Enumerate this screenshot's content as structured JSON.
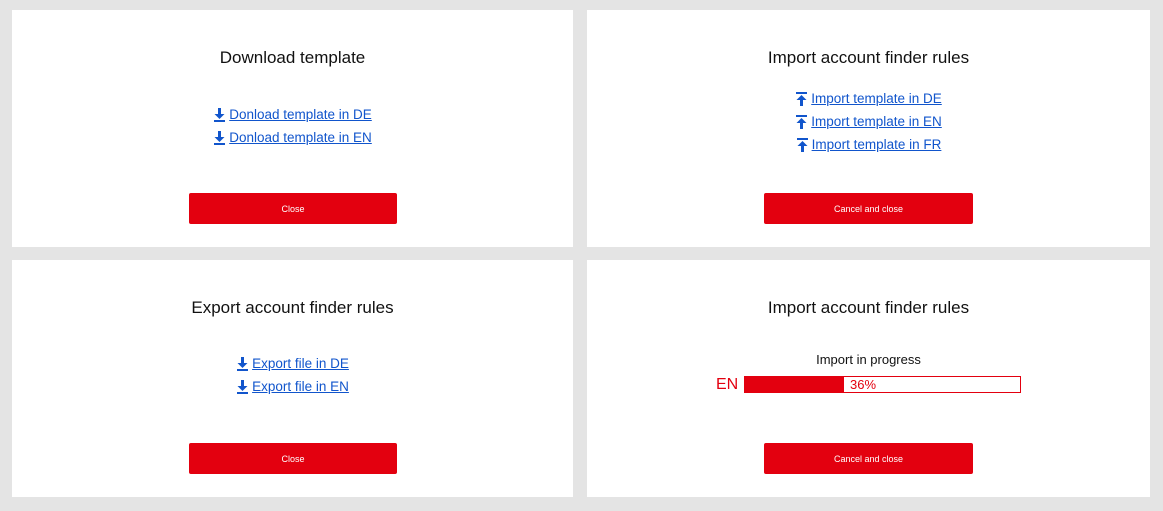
{
  "panels": {
    "download_template": {
      "title": "Download template",
      "links": [
        "Donload template in DE",
        "Donload template in EN"
      ],
      "button": "Close"
    },
    "import_rules": {
      "title": "Import account finder rules",
      "links": [
        "Import template in DE",
        "Import template in EN",
        "Import template in FR"
      ],
      "button": "Cancel and close"
    },
    "export_rules": {
      "title": "Export account finder rules",
      "links": [
        "Export file in DE",
        "Export file in EN"
      ],
      "button": "Close"
    },
    "import_progress": {
      "title": "Import account finder rules",
      "status": "Import in progress",
      "language": "EN",
      "progress_fraction": 0.36,
      "progress_text": "36%",
      "button": "Cancel and close"
    }
  },
  "colors": {
    "accent": "#e3000f",
    "link": "#1155cc",
    "background": "#e4e4e4"
  },
  "icons": {
    "download": "download-arrow-icon",
    "upload": "upload-arrow-icon"
  }
}
